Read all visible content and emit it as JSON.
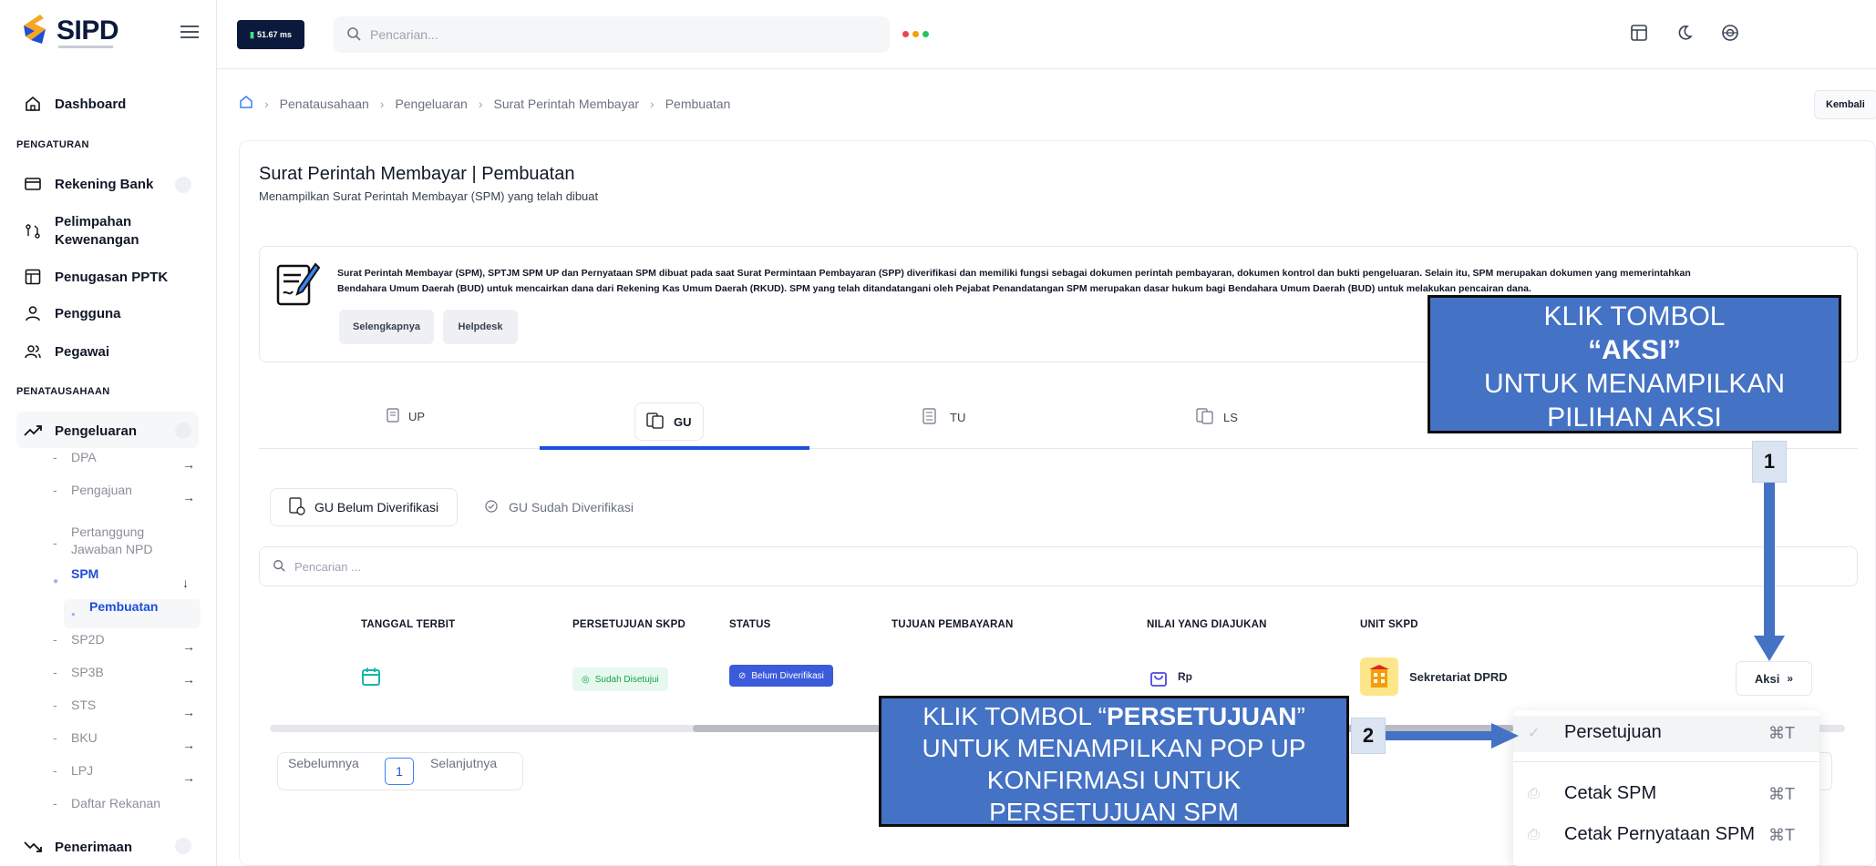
{
  "app": {
    "name": "SIPD",
    "network_label": "51.67 ms"
  },
  "topbar": {
    "search_placeholder": "Pencarian..."
  },
  "sidebar": {
    "dashboard": "Dashboard",
    "section_pengaturan": "PENGATURAN",
    "rekening_bank": "Rekening Bank",
    "pelimpahan_line1": "Pelimpahan",
    "pelimpahan_line2": "Kewenangan",
    "penugasan": "Penugasan PPTK",
    "pengguna": "Pengguna",
    "pegawai": "Pegawai",
    "section_penatausahaan": "PENATAUSAHAAN",
    "pengeluaran": "Pengeluaran",
    "sub_items": [
      "DPA",
      "Pengajuan",
      "Pertanggung",
      "Jawaban NPD",
      "SPM",
      "Pembuatan",
      "SP2D",
      "SP3B",
      "STS",
      "BKU",
      "LPJ",
      "Daftar Rekanan"
    ],
    "penerimaan": "Penerimaan"
  },
  "breadcrumb": [
    "Penatausahaan",
    "Pengeluaran",
    "Surat Perintah Membayar",
    "Pembuatan"
  ],
  "kembali_label": "Kembali",
  "page": {
    "title": "Surat Perintah Membayar | Pembuatan",
    "subtitle": "Menampilkan Surat Perintah Membayar (SPM) yang telah dibuat",
    "info_line1": "Surat Perintah Membayar (SPM), SPTJM SPM UP dan Pernyataan SPM dibuat pada saat Surat Permintaan Pembayaran (SPP) diverifikasi dan memiliki fungsi sebagai dokumen perintah pembayaran, dokumen kontrol dan bukti pengeluaran. Selain itu, SPM merupakan dokumen yang memerintahkan",
    "info_line2": "Bendahara Umum Daerah (BUD) untuk mencairkan dana dari Rekening Kas Umum Daerah (RKUD). SPM yang telah ditandatangani oleh Pejabat Penandatangan SPM merupakan dasar hukum bagi Bendahara Umum Daerah (BUD) untuk melakukan pencairan dana.",
    "btn_selengkapnya": "Selengkapnya",
    "btn_helpdesk": "Helpdesk"
  },
  "tabs": [
    "UP",
    "GU",
    "TU",
    "LS"
  ],
  "subtabs": [
    "GU Belum Diverifikasi",
    "GU Sudah Diverifikasi"
  ],
  "table_search_placeholder": "Pencarian ...",
  "table": {
    "headers": [
      "TANGGAL TERBIT",
      "PERSETUJUAN SKPD",
      "STATUS",
      "TUJUAN PEMBAYARAN",
      "NILAI YANG DIAJUKAN",
      "UNIT SKPD"
    ],
    "row": {
      "persetujuan": "Sudah Disetujui",
      "status": "Belum Diverifikasi",
      "nilai": "Rp",
      "unit": "Sekretariat DPRD",
      "aksi": "Aksi"
    }
  },
  "pager": {
    "prev": "Sebelumnya",
    "page": "1",
    "next": "Selanjutnya"
  },
  "dropdown": [
    {
      "label": "Persetujuan",
      "shortcut": "⌘T"
    },
    {
      "label": "Cetak SPM",
      "shortcut": "⌘T"
    },
    {
      "label": "Cetak Pernyataan SPM",
      "shortcut": "⌘T"
    }
  ],
  "annotations": {
    "callout1_l1": "KLIK TOMBOL",
    "callout1_l2": "“AKSI”",
    "callout1_l3": "UNTUK MENAMPILKAN",
    "callout1_l4": "PILIHAN AKSI",
    "callout2_l1a": "KLIK TOMBOL “",
    "callout2_l1b": "PERSETUJUAN",
    "callout2_l1c": "”",
    "callout2_l2": "UNTUK MENAMPILKAN POP UP",
    "callout2_l3": "KONFIRMASI UNTUK",
    "callout2_l4": "PERSETUJUAN SPM",
    "step1": "1",
    "step2": "2"
  }
}
